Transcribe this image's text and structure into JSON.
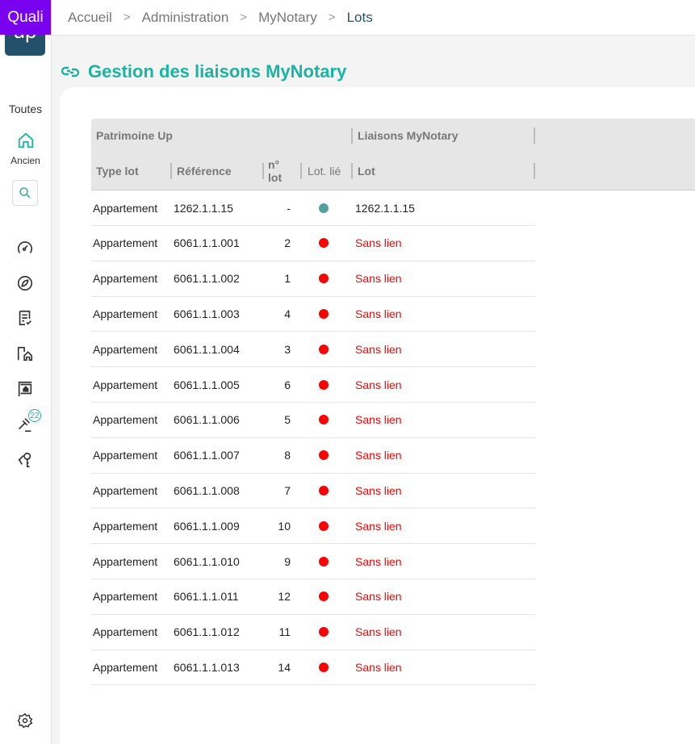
{
  "brand": {
    "badge": "Quali",
    "logo": "up"
  },
  "sidebar": {
    "scope": "Toutes",
    "home_label": "Ancien",
    "notification_count": "22",
    "icons": [
      "gauge-icon",
      "compass-icon",
      "checklist-icon",
      "buildings-home-icon",
      "sign-board-icon",
      "gavel-icon",
      "keys-icon"
    ]
  },
  "breadcrumb": [
    "Accueil",
    "Administration",
    "MyNotary",
    "Lots"
  ],
  "page": {
    "title": "Gestion des liaisons MyNotary"
  },
  "table": {
    "groups": [
      "Patrimoine Up",
      "Liaisons MyNotary"
    ],
    "columns": [
      "Type lot",
      "Référence",
      "n° lot",
      "Lot. lié",
      "Lot"
    ],
    "colors": {
      "linked": "#559ea0",
      "unlinked": "#ff0000"
    },
    "rows": [
      {
        "type": "Appartement",
        "ref": "1262.1.1.15",
        "num": "-",
        "linked": true,
        "lot": "1262.1.1.15"
      },
      {
        "type": "Appartement",
        "ref": "6061.1.1.001",
        "num": "2",
        "linked": false,
        "lot": "Sans lien"
      },
      {
        "type": "Appartement",
        "ref": "6061.1.1.002",
        "num": "1",
        "linked": false,
        "lot": "Sans lien"
      },
      {
        "type": "Appartement",
        "ref": "6061.1.1.003",
        "num": "4",
        "linked": false,
        "lot": "Sans lien"
      },
      {
        "type": "Appartement",
        "ref": "6061.1.1.004",
        "num": "3",
        "linked": false,
        "lot": "Sans lien"
      },
      {
        "type": "Appartement",
        "ref": "6061.1.1.005",
        "num": "6",
        "linked": false,
        "lot": "Sans lien"
      },
      {
        "type": "Appartement",
        "ref": "6061.1.1.006",
        "num": "5",
        "linked": false,
        "lot": "Sans lien"
      },
      {
        "type": "Appartement",
        "ref": "6061.1.1.007",
        "num": "8",
        "linked": false,
        "lot": "Sans lien"
      },
      {
        "type": "Appartement",
        "ref": "6061.1.1.008",
        "num": "7",
        "linked": false,
        "lot": "Sans lien"
      },
      {
        "type": "Appartement",
        "ref": "6061.1.1.009",
        "num": "10",
        "linked": false,
        "lot": "Sans lien"
      },
      {
        "type": "Appartement",
        "ref": "6061.1.1.010",
        "num": "9",
        "linked": false,
        "lot": "Sans lien"
      },
      {
        "type": "Appartement",
        "ref": "6061.1.1.011",
        "num": "12",
        "linked": false,
        "lot": "Sans lien"
      },
      {
        "type": "Appartement",
        "ref": "6061.1.1.012",
        "num": "11",
        "linked": false,
        "lot": "Sans lien"
      },
      {
        "type": "Appartement",
        "ref": "6061.1.1.013",
        "num": "14",
        "linked": false,
        "lot": "Sans lien"
      }
    ]
  }
}
